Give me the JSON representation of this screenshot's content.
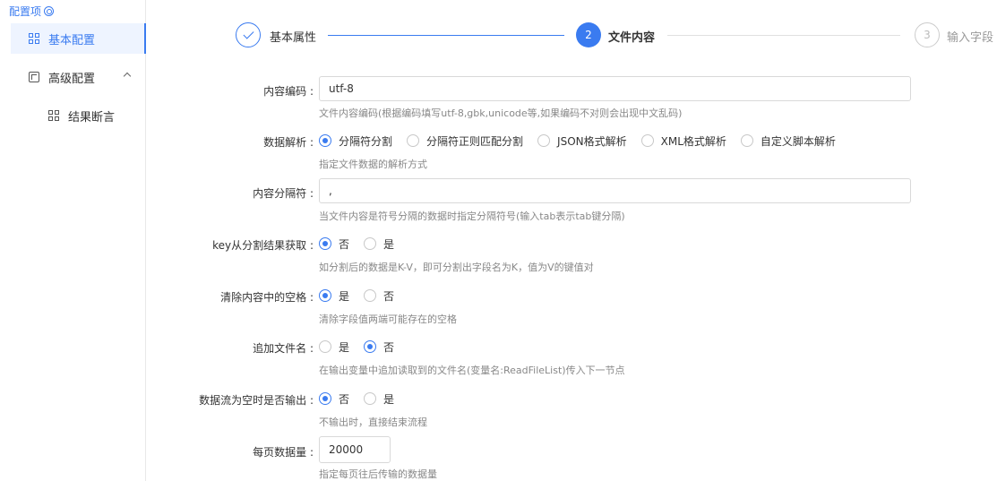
{
  "sidebar": {
    "header": "配置项",
    "items": [
      {
        "label": "基本配置",
        "active": true
      },
      {
        "label": "高级配置",
        "active": false
      },
      {
        "label": "结果断言",
        "active": false
      }
    ]
  },
  "steps": [
    {
      "title": "基本属性",
      "state": "done"
    },
    {
      "num": "2",
      "title": "文件内容",
      "state": "current"
    },
    {
      "num": "3",
      "title": "输入字段",
      "state": "todo"
    }
  ],
  "colors": {
    "accent": "#3a7bf0",
    "line_done": "#3a7bf0",
    "line_todo": "#e0e0e0"
  },
  "form": {
    "encoding": {
      "label": "内容编码 :",
      "value": "utf-8",
      "help": "文件内容编码(根据编码填写utf-8,gbk,unicode等,如果编码不对则会出现中文乱码)"
    },
    "parse": {
      "label": "数据解析 :",
      "options": [
        "分隔符分割",
        "分隔符正则匹配分割",
        "JSON格式解析",
        "XML格式解析",
        "自定义脚本解析"
      ],
      "selected": 0,
      "help": "指定文件数据的解析方式"
    },
    "delimiter": {
      "label": "内容分隔符 :",
      "value": ",",
      "help": "当文件内容是符号分隔的数据时指定分隔符号(输入tab表示tab键分隔)"
    },
    "key_from_split": {
      "label": "key从分割结果获取 :",
      "options": [
        "否",
        "是"
      ],
      "selected": 0,
      "help": "如分割后的数据是K-V，即可分割出字段名为K，值为V的键值对"
    },
    "trim_spaces": {
      "label": "清除内容中的空格 :",
      "options": [
        "是",
        "否"
      ],
      "selected": 0,
      "help": "清除字段值两端可能存在的空格"
    },
    "append_filename": {
      "label": "追加文件名 :",
      "options": [
        "是",
        "否"
      ],
      "selected": 1,
      "help": "在输出变量中追加读取到的文件名(变量名:ReadFileList)传入下一节点"
    },
    "output_empty": {
      "label": "数据流为空时是否输出 :",
      "options": [
        "否",
        "是"
      ],
      "selected": 0,
      "help": "不输出时，直接结束流程"
    },
    "page_size": {
      "label": "每页数据量 :",
      "value": "20000",
      "help": "指定每页往后传输的数据量"
    }
  }
}
